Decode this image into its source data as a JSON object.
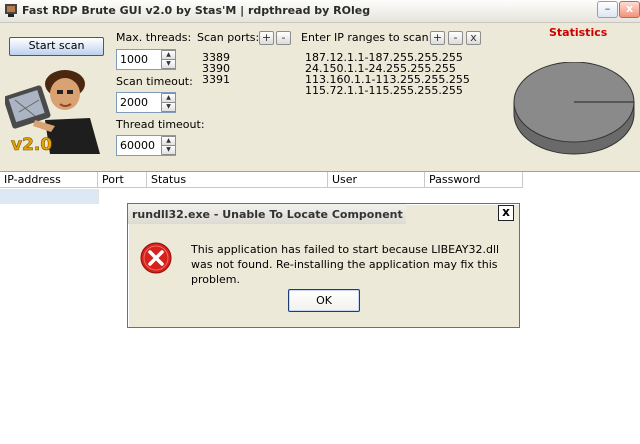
{
  "window": {
    "title": "Fast RDP Brute GUI v2.0 by Stas'M | rdpthread by ROleg",
    "minimize": "–",
    "close": "x"
  },
  "logo": {
    "badge": "v2.0"
  },
  "start_scan_label": "Start scan",
  "max_threads": {
    "label": "Max. threads:",
    "value": "1000"
  },
  "scan_timeout": {
    "label": "Scan timeout:",
    "value": "2000"
  },
  "thread_timeout": {
    "label": "Thread timeout:",
    "value": "60000"
  },
  "scan_ports": {
    "label": "Scan ports:",
    "add": "+",
    "remove": "-",
    "items": [
      "3389",
      "3390",
      "3391"
    ]
  },
  "ip_ranges": {
    "label": "Enter IP ranges to scan:",
    "add": "+",
    "remove": "-",
    "clear": "x",
    "items": [
      "187.12.1.1-187.255.255.255",
      "24.150.1.1-24.255.255.255",
      "113.160.1.1-113.255.255.255",
      "115.72.1.1-115.255.255.255"
    ]
  },
  "statistics": {
    "label": "Statistics",
    "color": "#cc0000"
  },
  "table": {
    "columns": [
      "IP-address",
      "Port",
      "Status",
      "User",
      "Password"
    ]
  },
  "dialog": {
    "title": "rundll32.exe - Unable To Locate Component",
    "close": "x",
    "message": "This application has failed to start because LIBEAY32.dll was not found. Re-installing the application may fix this problem.",
    "ok": "OK"
  }
}
